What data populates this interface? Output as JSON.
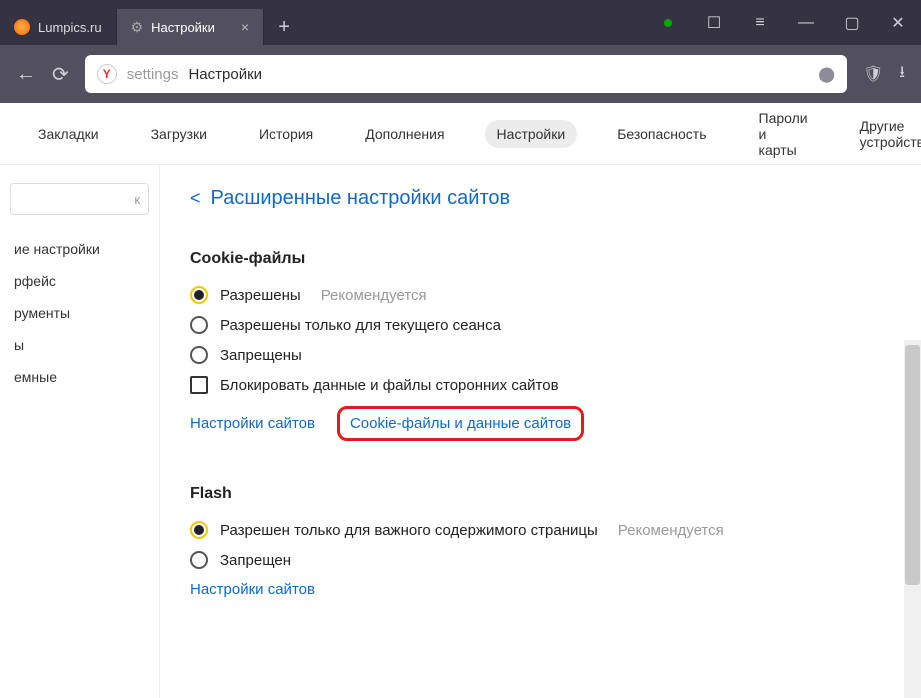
{
  "titlebar": {
    "tabs": [
      {
        "label": "Lumpics.ru"
      },
      {
        "label": "Настройки"
      }
    ]
  },
  "address": {
    "seg1": "settings",
    "seg2": "Настройки"
  },
  "nav": {
    "items": [
      "Закладки",
      "Загрузки",
      "История",
      "Дополнения",
      "Настройки",
      "Безопасность",
      "Пароли и карты",
      "Другие устройства"
    ],
    "active": 4
  },
  "sidebar": {
    "search_placeholder": "к",
    "items": [
      "ие настройки",
      "рфейс",
      "рументы",
      "ы",
      "емные"
    ]
  },
  "content": {
    "breadcrumb": "Расширенные настройки сайтов",
    "cookies": {
      "title": "Cookie-файлы",
      "opt_allowed": "Разрешены",
      "opt_allowed_hint": "Рекомендуется",
      "opt_session": "Разрешены только для текущего сеанса",
      "opt_blocked": "Запрещены",
      "opt_thirdparty": "Блокировать данные и файлы сторонних сайтов",
      "link_sites": "Настройки сайтов",
      "link_cookiedata": "Cookie-файлы и данные сайтов"
    },
    "flash": {
      "title": "Flash",
      "opt_important": "Разрешен только для важного содержимого страницы",
      "opt_important_hint": "Рекомендуется",
      "opt_blocked": "Запрещен",
      "link_sites": "Настройки сайтов"
    }
  }
}
